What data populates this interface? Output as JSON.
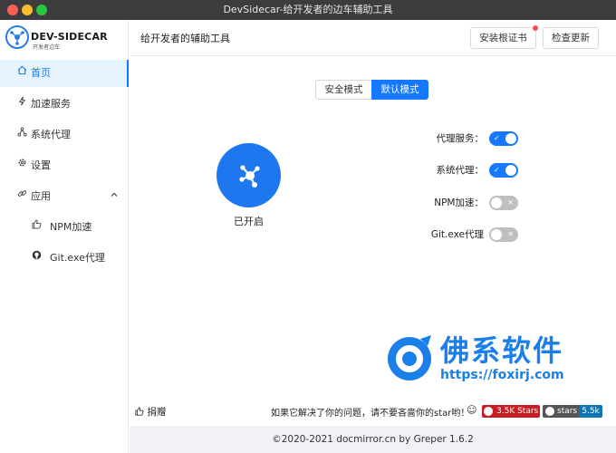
{
  "window": {
    "title": "DevSidecar-给开发者的边车辅助工具"
  },
  "logo": {
    "name": "DEV-SIDECAR",
    "tagline": "开发者边车"
  },
  "sidebar": {
    "items": [
      {
        "label": "首页",
        "icon": "home-icon",
        "active": true
      },
      {
        "label": "加速服务",
        "icon": "thunder-icon"
      },
      {
        "label": "系统代理",
        "icon": "cluster-icon"
      },
      {
        "label": "设置",
        "icon": "gear-icon"
      },
      {
        "label": "应用",
        "icon": "link-icon",
        "expanded": true
      },
      {
        "label": "NPM加速",
        "icon": "thumbs-up-icon",
        "sub": true
      },
      {
        "label": "Git.exe代理",
        "icon": "github-icon",
        "sub": true
      }
    ]
  },
  "header": {
    "title": "给开发者的辅助工具",
    "install_cert": "安装根证书",
    "check_update": "检查更新"
  },
  "modes": {
    "safe": "安全模式",
    "default": "默认模式",
    "selected": "default"
  },
  "main_toggle": {
    "status": "已开启"
  },
  "switches": [
    {
      "label": "代理服务：",
      "on": true
    },
    {
      "label": "系统代理：",
      "on": true
    },
    {
      "label": "NPM加速：",
      "on": false
    },
    {
      "label": "Git.exe代理",
      "on": false
    }
  ],
  "bottom": {
    "donate": "捐赠",
    "star_message": "如果它解决了你的问题，请不要吝啬你的star哟！",
    "gitee_badge": "3.5K Stars",
    "github_badge_label": "stars",
    "github_badge_value": "5.5k"
  },
  "footer": {
    "text": "©2020-2021 docmirror.cn by Greper 1.6.2"
  },
  "watermark": {
    "name": "佛系软件",
    "url": "https://foxirj.com"
  },
  "colors": {
    "accent": "#1677ff",
    "big_button": "#1f77f0",
    "gitee": "#c71d23",
    "github_value": "#0e75b6"
  }
}
